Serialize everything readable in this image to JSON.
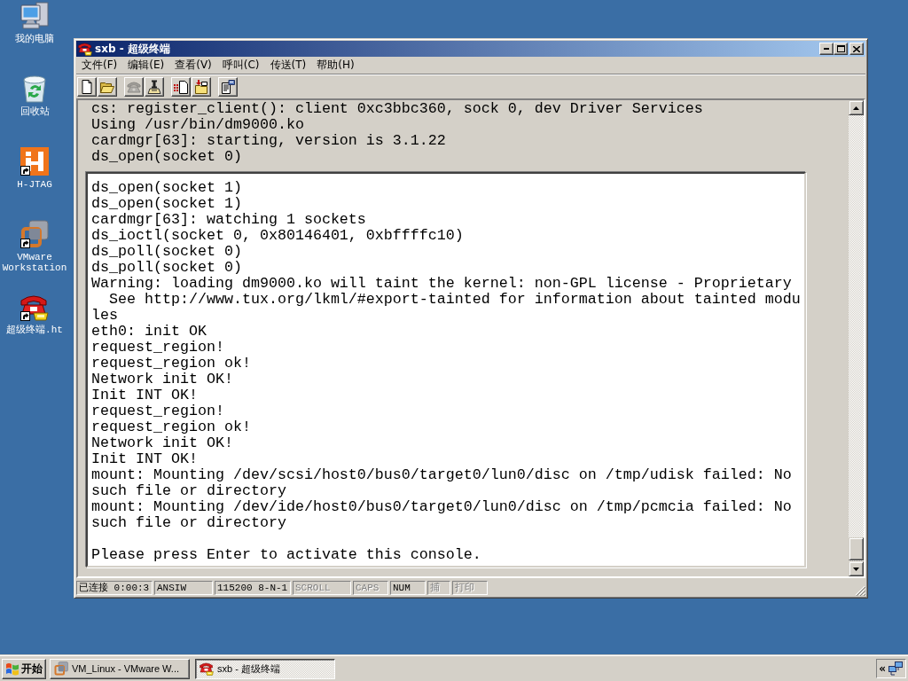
{
  "desktop_icons": [
    {
      "kind": "computer",
      "label": "我的电脑",
      "shortcut": false
    },
    {
      "kind": "recycle_bin",
      "label": "回收站",
      "shortcut": false
    },
    {
      "kind": "hjtag",
      "label": "H-JTAG",
      "shortcut": true
    },
    {
      "kind": "vmware",
      "label": "VMware Workstation",
      "shortcut": true
    },
    {
      "kind": "phone",
      "label": "超级终端.ht",
      "shortcut": true
    }
  ],
  "window": {
    "title": "sxb - 超级终端"
  },
  "menu_bar": [
    "文件(F)",
    "编辑(E)",
    "查看(V)",
    "呼叫(C)",
    "传送(T)",
    "帮助(H)"
  ],
  "toolbar": [
    [
      {
        "kind": "new",
        "disabled": false
      },
      {
        "kind": "open",
        "disabled": false
      }
    ],
    [
      {
        "kind": "call",
        "disabled": true
      },
      {
        "kind": "hangup",
        "disabled": false
      }
    ],
    [
      {
        "kind": "send",
        "disabled": false
      },
      {
        "kind": "receive",
        "disabled": false
      }
    ],
    [
      {
        "kind": "properties",
        "disabled": false
      }
    ]
  ],
  "terminal": {
    "lines": [
      "cs: register_client(): client 0xc3bbc360, sock 0, dev Driver Services",
      "Using /usr/bin/dm9000.ko",
      "cardmgr[63]: starting, version is 3.1.22",
      "ds_open(socket 0)"
    ],
    "overlay": {
      "lines": [
        "ds_open(socket 1)",
        "ds_open(socket 1)",
        "cardmgr[63]: watching 1 sockets",
        "ds_ioctl(socket 0, 0x80146401, 0xbffffc10)",
        "ds_poll(socket 0)",
        "ds_poll(socket 0)",
        "Warning: loading dm9000.ko will taint the kernel: non-GPL license - Proprietary",
        "  See http://www.tux.org/lkml/#export-tainted for information about tainted modu",
        "les",
        "eth0: init OK",
        "request_region!",
        "request_region ok!",
        "Network init OK!",
        "Init INT OK!",
        "request_region!",
        "request_region ok!",
        "Network init OK!",
        "Init INT OK!",
        "mount: Mounting /dev/scsi/host0/bus0/target0/lun0/disc on /tmp/udisk failed: No",
        "such file or directory",
        "mount: Mounting /dev/ide/host0/bus0/target0/lun0/disc on /tmp/pcmcia failed: No",
        "such file or directory"
      ],
      "prompt": "Please press Enter to activate this console."
    }
  },
  "status_bar": [
    {
      "text": "已连接 0:00:3",
      "active": true
    },
    {
      "text": "ANSIW",
      "active": true
    },
    {
      "text": "115200 8-N-1",
      "active": true
    },
    {
      "text": "SCROLL",
      "active": false
    },
    {
      "text": "CAPS",
      "active": false
    },
    {
      "text": "NUM",
      "active": true
    },
    {
      "text": "捕",
      "active": false
    },
    {
      "text": "打印",
      "active": false
    }
  ],
  "taskbar": {
    "start": "开始",
    "tasks": [
      {
        "kind": "vmware",
        "label": "VM_Linux - VMware W...",
        "selected": false
      },
      {
        "kind": "phone",
        "label": "sxb - 超级终端",
        "selected": true
      }
    ],
    "tray": {
      "chevron": "«"
    }
  }
}
